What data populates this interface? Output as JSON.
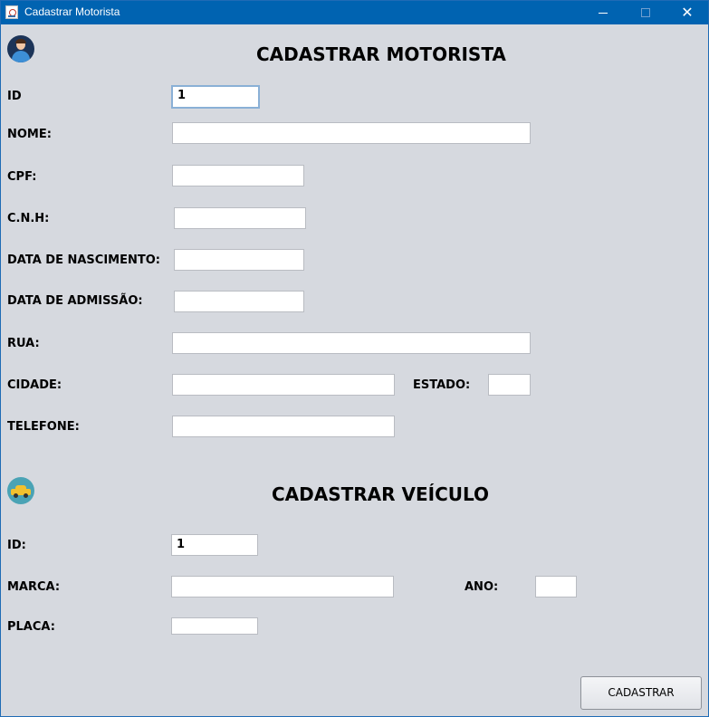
{
  "window": {
    "title": "Cadastrar Motorista",
    "min_symbol": "—",
    "max_symbol": "☐",
    "close_symbol": "✕"
  },
  "driver": {
    "section_title": "CADASTRAR MOTORISTA",
    "icon": "driver-avatar-icon",
    "fields": {
      "id": {
        "label": "ID",
        "value": "1"
      },
      "nome": {
        "label": "NOME:",
        "value": ""
      },
      "cpf": {
        "label": "CPF:",
        "value": ""
      },
      "cnh": {
        "label": "C.N.H:",
        "value": ""
      },
      "nascimento": {
        "label": "DATA DE NASCIMENTO:",
        "value": ""
      },
      "admissao": {
        "label": "DATA DE ADMISSÃO:",
        "value": ""
      },
      "rua": {
        "label": "RUA:",
        "value": ""
      },
      "cidade": {
        "label": "CIDADE:",
        "value": ""
      },
      "estado": {
        "label": "ESTADO:",
        "value": ""
      },
      "telefone": {
        "label": "TELEFONE:",
        "value": ""
      }
    }
  },
  "vehicle": {
    "section_title": "CADASTRAR VEÍCULO",
    "icon": "car-icon",
    "fields": {
      "id": {
        "label": "ID:",
        "value": "1"
      },
      "marca": {
        "label": "MARCA:",
        "value": ""
      },
      "ano": {
        "label": "ANO:",
        "value": ""
      },
      "placa": {
        "label": "PLACA:",
        "value": ""
      }
    }
  },
  "actions": {
    "submit_label": "CADASTRAR"
  },
  "colors": {
    "titlebar": "#0063b1",
    "background": "#d6d9df",
    "field": "#ffffff"
  }
}
